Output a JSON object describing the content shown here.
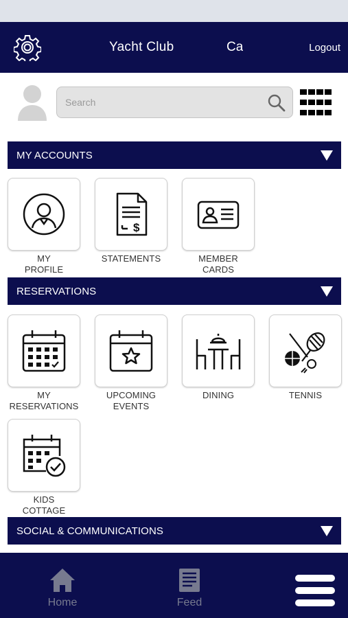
{
  "header": {
    "title": "Yacht Club",
    "cal_label": "Ca",
    "logout_label": "Logout"
  },
  "search": {
    "placeholder": "Search"
  },
  "sections": {
    "accounts": {
      "label": "MY ACCOUNTS"
    },
    "reservations": {
      "label": "RESERVATIONS"
    },
    "social": {
      "label": "SOCIAL & COMMUNICATIONS"
    }
  },
  "tiles": {
    "my_profile": {
      "line1": "MY",
      "line2": "PROFILE"
    },
    "statements": {
      "line1": "STATEMENTS",
      "line2": ""
    },
    "member_cards": {
      "line1": "MEMBER",
      "line2": "CARDS"
    },
    "my_reservations": {
      "line1": "MY",
      "line2": "RESERVATIONS"
    },
    "upcoming_events": {
      "line1": "UPCOMING",
      "line2": "EVENTS"
    },
    "dining": {
      "line1": "DINING",
      "line2": ""
    },
    "tennis": {
      "line1": "TENNIS",
      "line2": ""
    },
    "kids_cottage": {
      "line1": "KIDS",
      "line2": "COTTAGE"
    }
  },
  "bottom_nav": {
    "home_label": "Home",
    "feed_label": "Feed"
  },
  "icons": {
    "settings": "gear-icon",
    "avatar": "user-silhouette-icon",
    "search": "magnifier-icon",
    "apps": "grid-icon",
    "collapse": "triangle-down-icon",
    "home": "house-icon",
    "feed": "newspaper-icon",
    "menu": "hamburger-icon"
  },
  "colors": {
    "navy": "#0c0e4e",
    "nav_inactive": "#777a8f",
    "status_bar": "#dfe3ea"
  }
}
